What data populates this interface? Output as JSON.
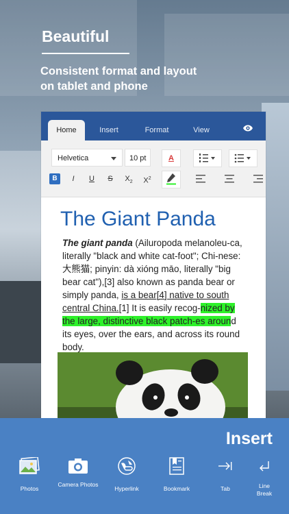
{
  "hero": {
    "title": "Beautiful",
    "subtitle_line1": "Consistent format and layout",
    "subtitle_line2": "on tablet and phone"
  },
  "tabs": [
    {
      "label": "Home",
      "active": true
    },
    {
      "label": "Insert",
      "active": false
    },
    {
      "label": "Format",
      "active": false
    },
    {
      "label": "View",
      "active": false
    }
  ],
  "ribbon": {
    "font_name": "Helvetica",
    "font_size": "10 pt",
    "bold": "B",
    "italic": "I",
    "underline": "U",
    "strike": "S",
    "subscript": "X",
    "subscript_mark": "2",
    "superscript": "X",
    "superscript_mark": "2",
    "font_color_letter": "A"
  },
  "document": {
    "title": "The Giant Panda",
    "p1_bold": "The giant panda",
    "p1_a": " (Ailuropoda melanoleu-ca, literally \"black and white cat-foot\"; Chi-nese: 大熊猫; pinyin: dà xióng māo, literally \"big bear cat\"),[3] also known as panda bear or simply panda, ",
    "p1_underline": "is a bear[4] native to south central China.",
    "p1_b": "[1] It is easily recog-",
    "p1_highlight": "nized by the large, distinctive black patch-es aroun",
    "p1_c": "d its eyes, over the ears, and across its round body."
  },
  "insert_bar": {
    "title": "Insert",
    "items": [
      {
        "label": "Photos",
        "icon": "photos-icon"
      },
      {
        "label": "Camera Photos",
        "icon": "camera-icon"
      },
      {
        "label": "Hyperlink",
        "icon": "hyperlink-icon"
      },
      {
        "label": "Bookmark",
        "icon": "bookmark-icon"
      },
      {
        "label": "Tab",
        "icon": "tab-icon"
      },
      {
        "label": "Line Break",
        "icon": "line-break-icon"
      }
    ]
  },
  "colors": {
    "brand_blue": "#2b579a",
    "bar_blue": "#4a81c4",
    "title_blue": "#2060b0",
    "highlight": "#2ef12a",
    "font_color_red": "#d83b3b"
  }
}
